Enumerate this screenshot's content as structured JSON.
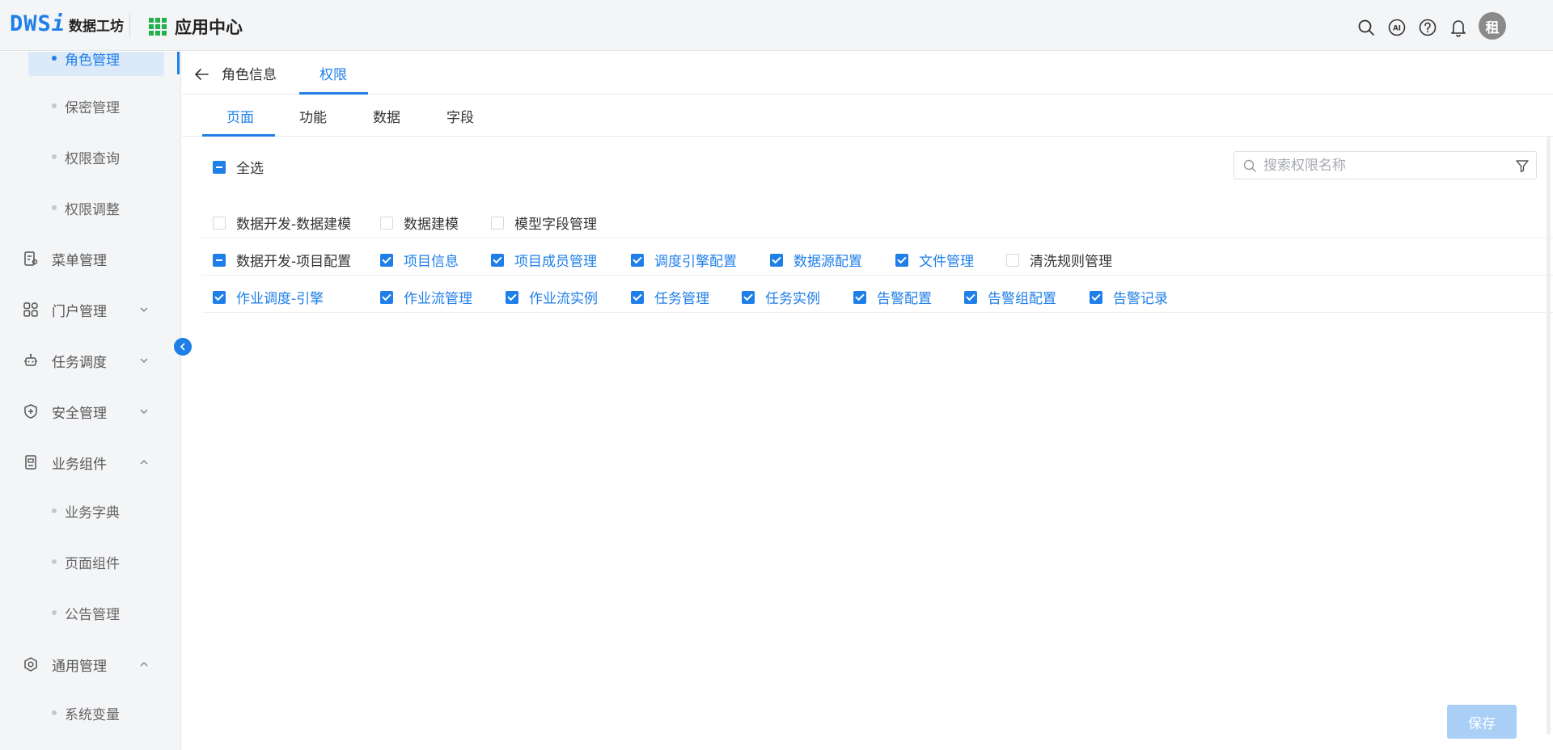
{
  "header": {
    "logo_mark": "DWS",
    "logo_mark_i": "i",
    "logo_text": "数据工坊",
    "app_center": "应用中心",
    "avatar_text": "租",
    "icons": [
      "search-icon",
      "ai-icon",
      "help-icon",
      "bell-icon"
    ]
  },
  "sidebar": {
    "subs_top": [
      {
        "label": "角色管理",
        "active": true
      },
      {
        "label": "保密管理"
      },
      {
        "label": "权限查询"
      },
      {
        "label": "权限调整"
      }
    ],
    "mains": [
      {
        "label": "菜单管理",
        "icon": "menu-doc-icon"
      },
      {
        "label": "门户管理",
        "icon": "portal-grid-icon",
        "chevron": "down"
      },
      {
        "label": "任务调度",
        "icon": "robot-icon",
        "chevron": "down"
      },
      {
        "label": "安全管理",
        "icon": "shield-icon",
        "chevron": "down"
      },
      {
        "label": "业务组件",
        "icon": "component-icon",
        "chevron": "up"
      }
    ],
    "subs_biz": [
      {
        "label": "业务字典"
      },
      {
        "label": "页面组件"
      },
      {
        "label": "公告管理"
      }
    ],
    "general": {
      "label": "通用管理",
      "icon": "settings-icon",
      "chevron": "up"
    },
    "subs_general": [
      {
        "label": "系统变量"
      }
    ]
  },
  "main": {
    "top_tabs": [
      {
        "label": "角色信息"
      },
      {
        "label": "权限",
        "active": true
      }
    ],
    "sub_tabs": [
      {
        "label": "页面",
        "active": true
      },
      {
        "label": "功能"
      },
      {
        "label": "数据"
      },
      {
        "label": "字段"
      }
    ],
    "select_all": {
      "label": "全选",
      "state": "partial"
    },
    "search": {
      "placeholder": "搜索权限名称",
      "value": ""
    },
    "rows": [
      {
        "items": [
          {
            "label": "数据开发-数据建模",
            "state": "unchecked"
          },
          {
            "label": "数据建模",
            "state": "unchecked"
          },
          {
            "label": "模型字段管理",
            "state": "unchecked"
          }
        ]
      },
      {
        "items": [
          {
            "label": "数据开发-项目配置",
            "state": "partial"
          },
          {
            "label": "项目信息",
            "state": "checked"
          },
          {
            "label": "项目成员管理",
            "state": "checked"
          },
          {
            "label": "调度引擎配置",
            "state": "checked"
          },
          {
            "label": "数据源配置",
            "state": "checked"
          },
          {
            "label": "文件管理",
            "state": "checked"
          },
          {
            "label": "清洗规则管理",
            "state": "unchecked"
          }
        ]
      },
      {
        "items": [
          {
            "label": "作业调度-引擎",
            "state": "checked"
          },
          {
            "label": "作业流管理",
            "state": "checked"
          },
          {
            "label": "作业流实例",
            "state": "checked"
          },
          {
            "label": "任务管理",
            "state": "checked"
          },
          {
            "label": "任务实例",
            "state": "checked"
          },
          {
            "label": "告警配置",
            "state": "checked"
          },
          {
            "label": "告警组配置",
            "state": "checked"
          },
          {
            "label": "告警记录",
            "state": "checked"
          }
        ]
      }
    ],
    "save_label": "保存"
  },
  "colors": {
    "accent": "#1f7fe8",
    "save_disabled": "#a9cff7",
    "green": "#22b14c"
  }
}
